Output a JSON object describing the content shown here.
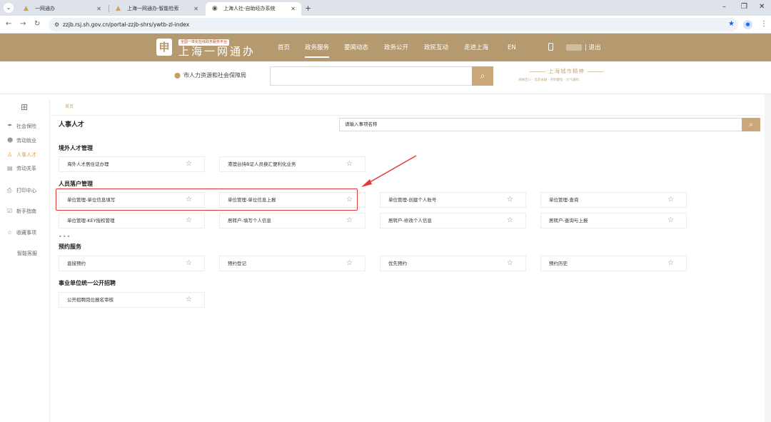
{
  "browser": {
    "tabs": [
      {
        "title": "一网通办",
        "active": false
      },
      {
        "title": "上海一网通办-智能检索",
        "active": false
      },
      {
        "title": "上海人社-自助经办系统",
        "active": true
      }
    ],
    "url": "zzjb.rsj.sh.gov.cn/portal-zzjb-shrs/ywtb-zl-index"
  },
  "site_header": {
    "logo_tag": "全国一体化在线政务服务平台",
    "logo_title": "上海一网通办",
    "nav": [
      "首页",
      "政务服务",
      "要闻动态",
      "政务公开",
      "政民互动",
      "走进上海",
      "EN"
    ],
    "active_nav": "政务服务",
    "logout": "| 退出"
  },
  "search_band": {
    "region": "市人力资源和社会保障局",
    "brand_title": "上海城市精神",
    "brand_sub": "海纳百川 · 追求卓越 · 开明睿智 · 大气谦和"
  },
  "sidebar": {
    "items": [
      {
        "label": "社会保险",
        "icon": "umbrella-icon"
      },
      {
        "label": "劳动就业",
        "icon": "worker-icon"
      },
      {
        "label": "人事人才",
        "icon": "person-icon",
        "active": true
      },
      {
        "label": "劳动关系",
        "icon": "document-icon"
      },
      {
        "label": "打印中心",
        "icon": "printer-icon"
      },
      {
        "label": "新手指南",
        "icon": "guide-icon"
      },
      {
        "label": "收藏事项",
        "icon": "star-icon"
      },
      {
        "label": "智能客服",
        "icon": "chat-icon"
      }
    ]
  },
  "main": {
    "breadcrumb": "首页",
    "title": "人事人才",
    "search_placeholder": "请输入事项名称",
    "sections": [
      {
        "title": "境外人才管理",
        "items": [
          "海外人才居住证办理",
          "港澳台持B证人员换汇便利化业务"
        ]
      },
      {
        "title": "人员落户管理",
        "items": [
          "单位管理-单位信息填写",
          "单位管理-单位信息上报",
          "单位管理-创建个人账号",
          "单位管理-查询",
          "单位管理-KEY授权管理",
          "居转户-填写个人信息",
          "居转户-修改个人信息",
          "居转户-查询与上报"
        ],
        "more": "•••"
      },
      {
        "title": "预约服务",
        "items": [
          "直接预约",
          "预约登记",
          "优先预约",
          "预约历史"
        ]
      },
      {
        "title": "事业单位统一公开招聘",
        "items": [
          "公开招聘岗位报名审核"
        ]
      }
    ]
  },
  "colors": {
    "brand_gold": "#b69a6f",
    "accent_gold": "#c9a779",
    "highlight_red": "#e23a3a"
  }
}
